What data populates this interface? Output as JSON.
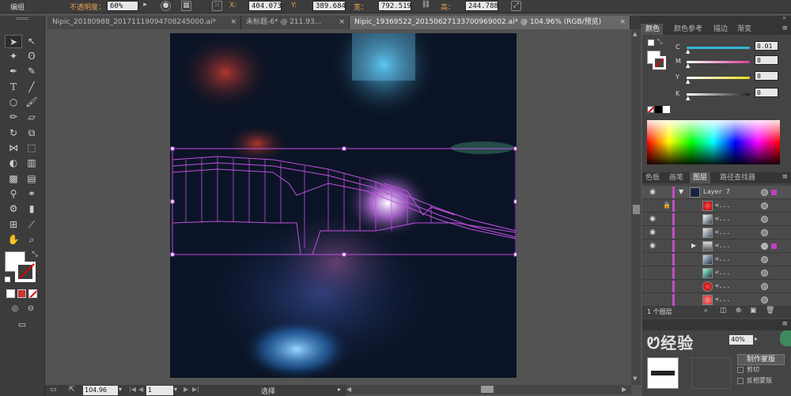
{
  "control_bar": {
    "group_label": "编组",
    "opacity_label": "不透明度：",
    "opacity_value": "60%",
    "x_label": "X:",
    "x_value": "404.073",
    "y_label": "Y:",
    "y_value": "389.684",
    "w_label": "宽：",
    "w_value": "792.519",
    "h_label": "高：",
    "h_value": "244.788"
  },
  "tabs": [
    {
      "label": "Nipic_20180988_20171119094708245000.ai*",
      "active": false
    },
    {
      "label": "未标题-6* @ 211.93...",
      "active": false
    },
    {
      "label": "Nipic_19369522_20150627133700969002.ai* @ 104.96% (RGB/预览)",
      "active": true
    }
  ],
  "status": {
    "zoom": "104.96",
    "page": "1",
    "mode": "选择"
  },
  "color_panel": {
    "tabs": [
      "颜色",
      "颜色参考",
      "描边",
      "渐变"
    ],
    "channels": [
      {
        "label": "C",
        "value": "0.01",
        "color": "#33b5d5"
      },
      {
        "label": "M",
        "value": "0",
        "color": "#d43f9a"
      },
      {
        "label": "Y",
        "value": "0",
        "color": "#e6dd1d"
      },
      {
        "label": "K",
        "value": "0",
        "color": "#222222"
      }
    ]
  },
  "layers_panel": {
    "tabs": [
      "色板",
      "画笔",
      "图层",
      "路径查找器"
    ],
    "layer_name": "Layer 7",
    "sublayer_name": "<...",
    "footer": "1 个图层"
  },
  "bottom_panel": {
    "opacity_value": "40%",
    "make_mask_button": "制作蒙版",
    "clip_label": "剪切",
    "invert_mask_label": "反相蒙版"
  },
  "watermark": "经验"
}
